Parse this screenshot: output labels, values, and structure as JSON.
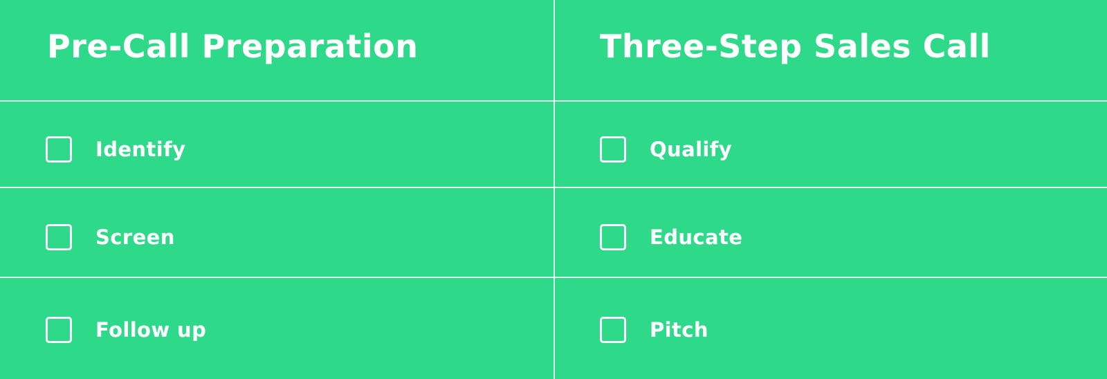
{
  "colors": {
    "background": "#2fd98a",
    "foreground": "#ffffff"
  },
  "columns": [
    {
      "title": "Pre-Call Preparation",
      "items": [
        {
          "label": "Identify",
          "checked": false
        },
        {
          "label": "Screen",
          "checked": false
        },
        {
          "label": "Follow up",
          "checked": false
        }
      ]
    },
    {
      "title": "Three-Step Sales Call",
      "items": [
        {
          "label": "Qualify",
          "checked": false
        },
        {
          "label": "Educate",
          "checked": false
        },
        {
          "label": "Pitch",
          "checked": false
        }
      ]
    }
  ]
}
